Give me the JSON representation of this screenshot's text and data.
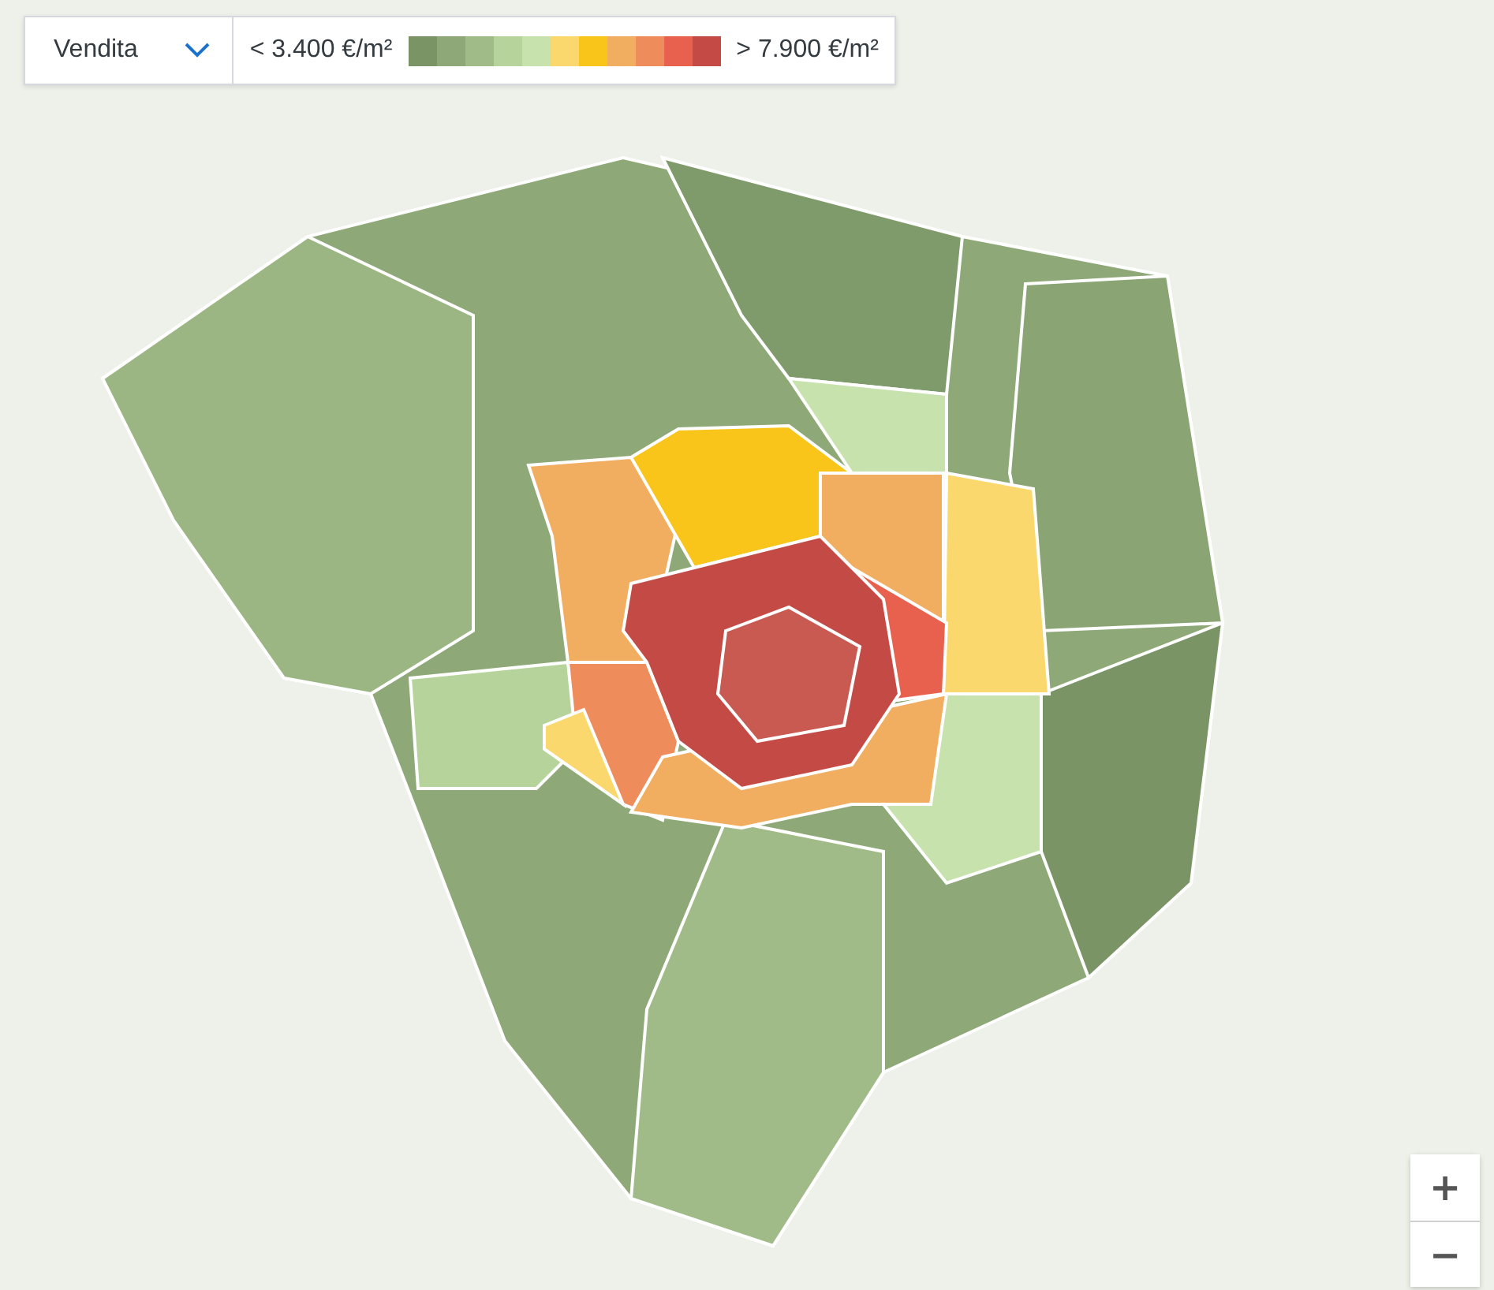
{
  "mode_select": {
    "value": "Vendita"
  },
  "legend": {
    "min_label": "< 3.400 €/m²",
    "max_label": "> 7.900 €/m²",
    "swatches": [
      {
        "color": "#7a9466"
      },
      {
        "color": "#8ea878"
      },
      {
        "color": "#a0bb88"
      },
      {
        "color": "#b5d39b"
      },
      {
        "color": "#c8e2ae"
      },
      {
        "color": "#fbd86e"
      },
      {
        "color": "#f9c51a"
      },
      {
        "color": "#f2ae60"
      },
      {
        "color": "#ef8c5c"
      },
      {
        "color": "#e8614f"
      },
      {
        "color": "#c44b45"
      }
    ]
  },
  "zoom_controls": [
    {
      "label": "+"
    },
    {
      "label": "−"
    }
  ]
}
